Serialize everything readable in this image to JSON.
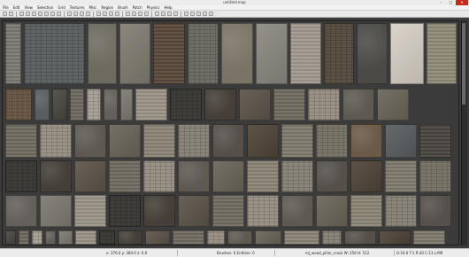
{
  "window": {
    "title": "untitled.map",
    "minimize": "–",
    "maximize": "□",
    "close": "✕"
  },
  "menu": [
    "File",
    "Edit",
    "View",
    "Selection",
    "Grid",
    "Textures",
    "Misc",
    "Region",
    "Brush",
    "Patch",
    "Physics",
    "Help"
  ],
  "toolbar": {
    "button_icons": [
      "open-icon",
      "save-icon",
      "undo-icon",
      "redo-icon",
      "flip-x-icon",
      "flip-y-icon",
      "rotate-x-icon",
      "rotate-y-icon",
      "rotate-z-icon",
      "select-touching-icon",
      "select-inside-icon",
      "select-partial-icon",
      "select-complete-icon",
      "csg-subtract-icon",
      "csg-merge-icon",
      "hollow-icon",
      "clipper-icon",
      "camera-icon",
      "texture-lock-icon",
      "rotate-lock-icon",
      "scale-lock-icon",
      "patch-icon",
      "curve-icon",
      "entity-icon",
      "lighting-icon",
      "texture-icon",
      "filter-icon",
      "region-icon",
      "plugin-icon",
      "bsp-icon"
    ]
  },
  "browser": {
    "textures": [
      {
        "color": "#7c7a74",
        "row": 1
      },
      {
        "color": "#5f6364",
        "row": 1
      },
      {
        "color": "#6d6a60",
        "row": 1
      },
      {
        "color": "#807c72",
        "row": 1
      },
      {
        "color": "#5a4a3c",
        "row": 1
      },
      {
        "color": "#6f6e66",
        "row": 1
      },
      {
        "color": "#7a7466",
        "row": 1
      },
      {
        "color": "#8a8880",
        "row": 1
      },
      {
        "color": "#a39a90",
        "row": 1
      },
      {
        "color": "#5a5043",
        "row": 1
      },
      {
        "color": "#4b4a46",
        "row": 1
      },
      {
        "color": "#d6d0c6",
        "row": 1
      },
      {
        "color": "#8f8c78",
        "row": 1
      },
      {
        "color": "#2c2c2c",
        "row": 1
      }
    ],
    "scrollbar": "vertical"
  },
  "status": {
    "grid_coords": "x: 376.0  y: 384.0  z: 0.0",
    "counts": "Brushes: 0 Entities: 0",
    "texture_name": "mj_wood_pillar_crack W: 256 H: 512",
    "grid_info": "G:16.0 T:1 R:30 C:13 L:MR"
  }
}
